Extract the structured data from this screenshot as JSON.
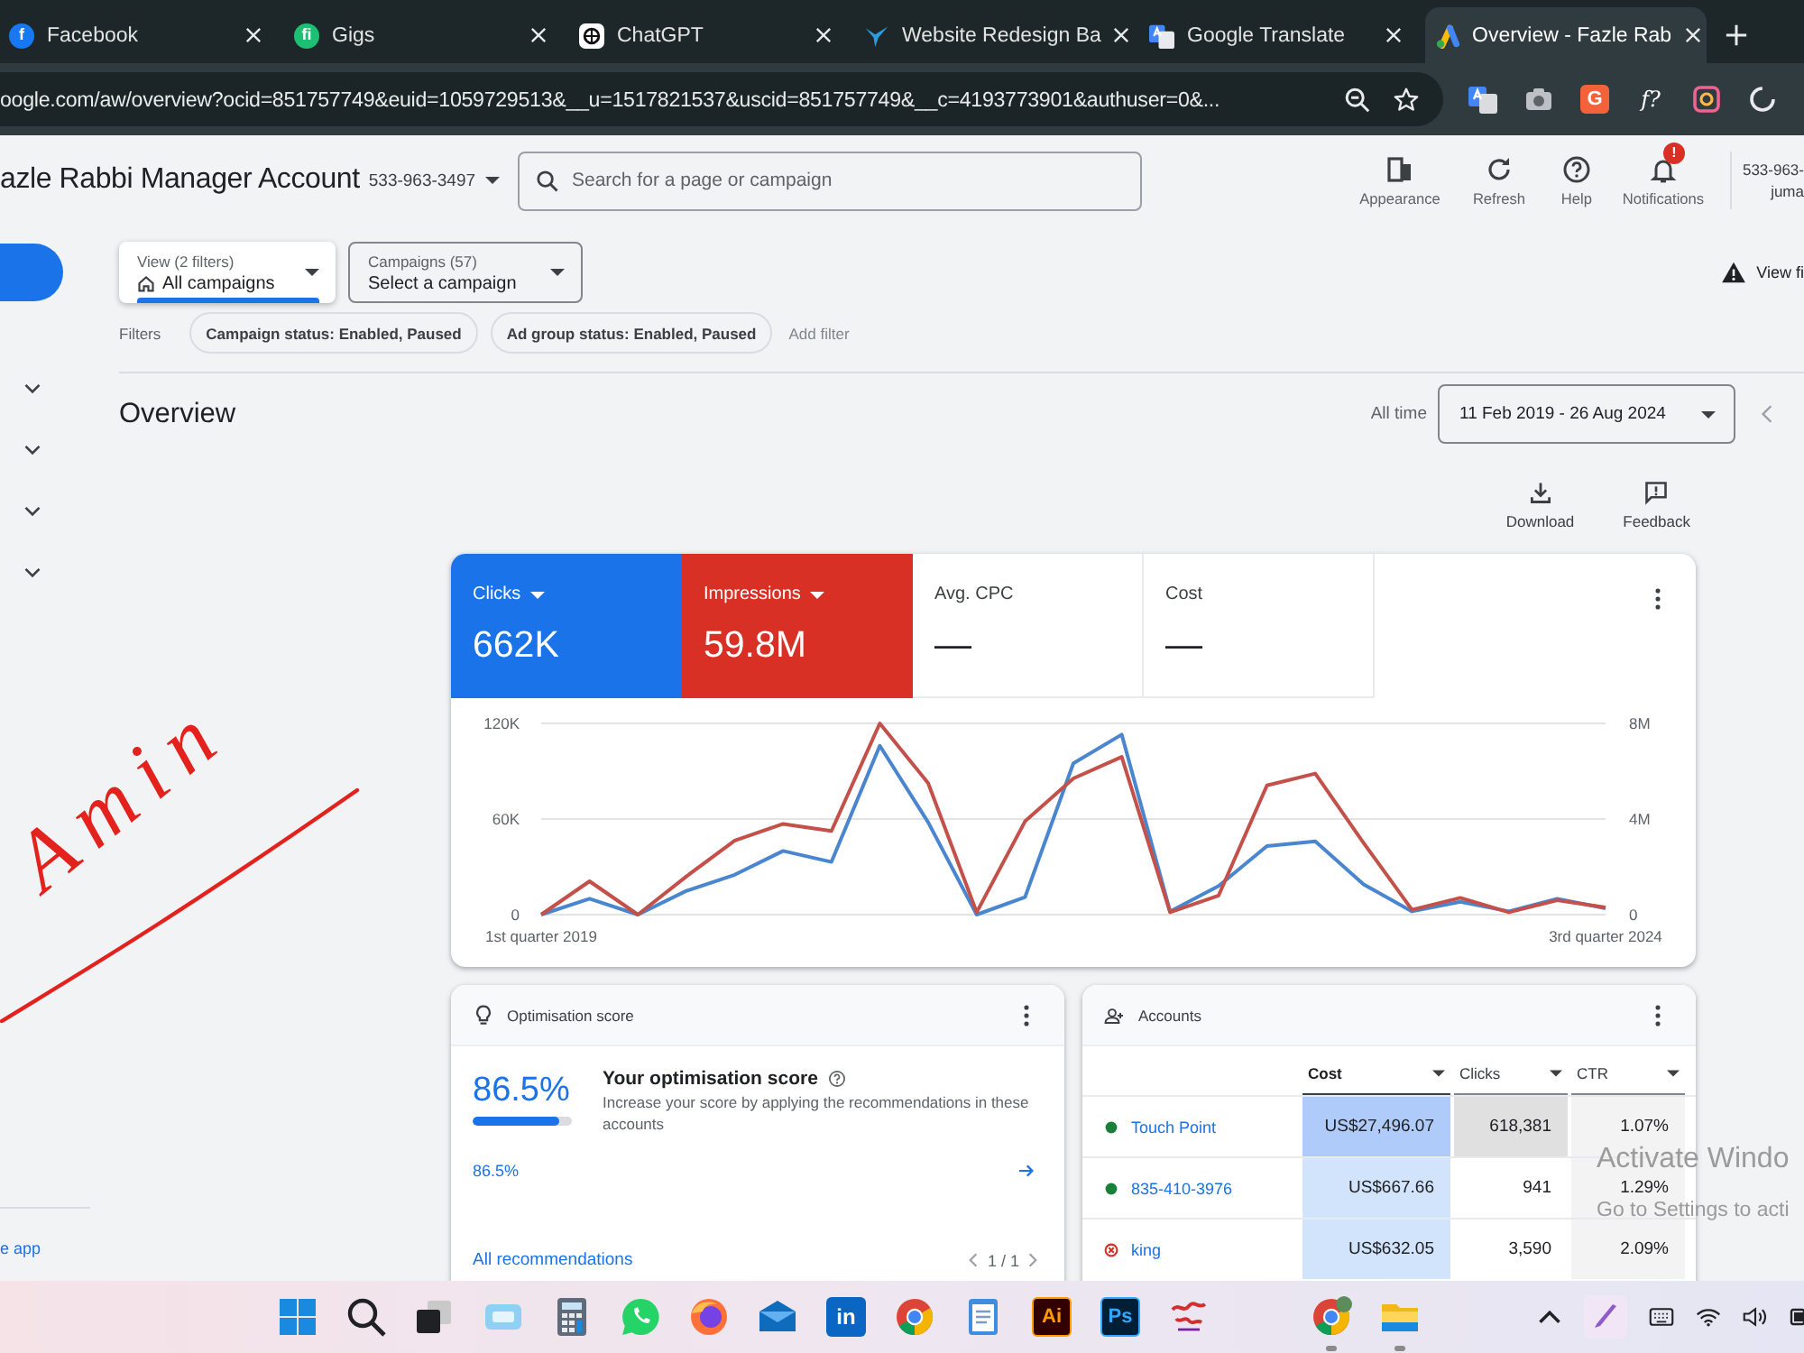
{
  "browser": {
    "tabs": [
      {
        "title": "Facebook",
        "logo": "f",
        "selected": false
      },
      {
        "title": "Gigs",
        "logo": "fi",
        "selected": false
      },
      {
        "title": "ChatGPT",
        "selected": false
      },
      {
        "title": "Website Redesign Ba",
        "selected": false
      },
      {
        "title": "Google Translate",
        "selected": false
      },
      {
        "title": "Overview - Fazle Rab",
        "selected": true
      }
    ],
    "address": "oogle.com/aw/overview?ocid=851757749&euid=1059729513&__u=1517821537&uscid=851757749&__c=4193773901&authuser=0&...",
    "extensions": [
      {
        "logo": "G"
      },
      {
        "logo": "f?"
      }
    ]
  },
  "account_header": {
    "name": "azle Rabbi Manager Account",
    "customer_id": "533-963-3497",
    "search": {
      "placeholder": "Search for a page or campaign"
    },
    "actions": [
      {
        "label": "Appearance"
      },
      {
        "label": "Refresh"
      },
      {
        "label": "Help"
      },
      {
        "label": "Notifications",
        "badge": "!"
      }
    ],
    "user": {
      "id": "533-963-",
      "name": "juma"
    }
  },
  "sidebar": {
    "footer_link": "e app"
  },
  "selectors": [
    {
      "kind": "view",
      "label": "View (2 filters)",
      "value": "All campaigns"
    },
    {
      "kind": "campaign",
      "label": "Campaigns (57)",
      "value": "Select a campaign"
    }
  ],
  "notice": "View fi",
  "filters": {
    "label": "Filters",
    "chips": [
      "Campaign status: Enabled, Paused",
      "Ad group status: Enabled, Paused"
    ],
    "add_label": "Add filter"
  },
  "overview": {
    "title": "Overview",
    "range_label": "All time",
    "date_range": "11 Feb 2019 - 26 Aug 2024",
    "actions": [
      {
        "label": "Download"
      },
      {
        "label": "Feedback"
      }
    ]
  },
  "performance_card": {
    "metrics": [
      {
        "label": "Clicks",
        "value": "662K",
        "selected": true,
        "color": "#1a73e8"
      },
      {
        "label": "Impressions",
        "value": "59.8M",
        "selected": true,
        "color": "#d93025"
      },
      {
        "label": "Avg. CPC",
        "value": "—",
        "selected": false
      },
      {
        "label": "Cost",
        "value": "—",
        "selected": false
      }
    ],
    "chart_data": {
      "type": "line",
      "categories": [
        "1st quarter 2019",
        null,
        null,
        null,
        null,
        null,
        null,
        null,
        null,
        null,
        null,
        null,
        null,
        null,
        null,
        null,
        null,
        null,
        null,
        null,
        null,
        null,
        "3rd quarter 2024"
      ],
      "ylim": [
        0,
        120000
      ],
      "yticks": [
        {
          "value": 0,
          "label": "0"
        },
        {
          "value": 60000,
          "label": "60K"
        },
        {
          "value": 120000,
          "label": "120K"
        }
      ],
      "y2lim": [
        0,
        8000000
      ],
      "y2ticks": [
        {
          "value": 0,
          "label": "0"
        },
        {
          "value": 4000000,
          "label": "4M"
        },
        {
          "value": 8000000,
          "label": "8M"
        }
      ],
      "series": [
        {
          "color": "#4a86d0",
          "values": [
            0,
            10000,
            0,
            15000,
            25000,
            40000,
            33000,
            106000,
            58000,
            0,
            11000,
            95000,
            113000,
            2000,
            18000,
            43000,
            46000,
            19000,
            2000,
            8000,
            2000,
            10000,
            4000
          ]
        },
        {
          "color": "#c4504a",
          "axis": "y2",
          "values": [
            0,
            1400000,
            0,
            1600000,
            3100000,
            3800000,
            3500000,
            8000000,
            5500000,
            100000,
            3900000,
            5700000,
            6600000,
            100000,
            800000,
            5400000,
            5900000,
            3000000,
            200000,
            700000,
            100000,
            600000,
            300000
          ]
        }
      ]
    }
  },
  "optimisation_card": {
    "title": "Optimisation score",
    "score": "86.5%",
    "level": 0.865,
    "heading": "Your optimisation score",
    "description": "Increase your score by applying the recommendations in these accounts",
    "score_link": "86.5%",
    "footer_link": "All recommendations",
    "pager": "1 / 1"
  },
  "accounts_card": {
    "title": "Accounts",
    "columns": [
      {
        "label": "Cost",
        "sorted": true
      },
      {
        "label": "Clicks",
        "sorted": false
      },
      {
        "label": "CTR",
        "sorted": false
      }
    ],
    "rows": [
      {
        "name": "Touch Point",
        "enabled": true,
        "cells": [
          {
            "text": "US$27,496.07",
            "color": "#aecbfa"
          },
          {
            "text": "618,381",
            "color": "#e0e0e0"
          },
          {
            "text": "1.07%",
            "color": "#f3f3f3"
          }
        ]
      },
      {
        "name": "835-410-3976",
        "enabled": true,
        "cells": [
          {
            "text": "US$667.66",
            "color": "#d2e3fc"
          },
          {
            "text": "941"
          },
          {
            "text": "1.29%",
            "color": "#f3f3f3"
          }
        ]
      },
      {
        "name": "king",
        "enabled": false,
        "cells": [
          {
            "text": "US$632.05",
            "color": "#d2e3fc"
          },
          {
            "text": "3,590"
          },
          {
            "text": "2.09%",
            "color": "#f3f3f3"
          }
        ]
      }
    ]
  },
  "windows_notice": {
    "title": "Activate Windo",
    "subtitle": "Go to Settings to acti"
  },
  "annotation": {
    "text": "Amin"
  },
  "taskbar": {
    "apps": [
      {
        "running": false
      },
      {
        "running": false
      },
      {
        "running": false
      },
      {
        "running": false
      },
      {
        "running": false
      },
      {
        "running": false
      },
      {
        "running": false
      },
      {
        "running": false
      },
      {
        "logo": "in",
        "running": false
      },
      {
        "running": false
      },
      {
        "running": false
      },
      {
        "logo": "Ai",
        "running": false
      },
      {
        "logo": "Ps",
        "running": false
      },
      {
        "running": false
      },
      {
        "running": true
      },
      {
        "running": true
      }
    ]
  }
}
